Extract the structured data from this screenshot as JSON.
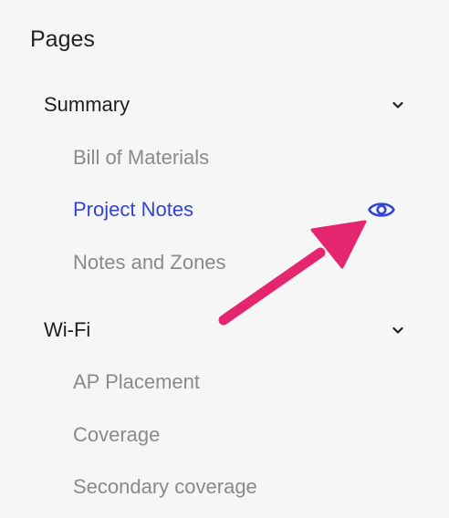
{
  "panel": {
    "title": "Pages"
  },
  "sections": [
    {
      "label": "Summary",
      "items": [
        {
          "label": "Bill of Materials",
          "active": false
        },
        {
          "label": "Project Notes",
          "active": true
        },
        {
          "label": "Notes and Zones",
          "active": false
        }
      ]
    },
    {
      "label": "Wi-Fi",
      "items": [
        {
          "label": "AP Placement",
          "active": false
        },
        {
          "label": "Coverage",
          "active": false
        },
        {
          "label": "Secondary coverage",
          "active": false
        }
      ]
    }
  ],
  "icons": {
    "section_toggle": "chevron-down-icon",
    "active_item_action": "eye-icon",
    "annotation": "arrow-annotation"
  },
  "colors": {
    "background": "#f6f6f6",
    "heading": "#222222",
    "section_label": "#1f1f1f",
    "item_default": "#8a8a8a",
    "item_active": "#3344d6",
    "annotation_arrow": "#e5266e"
  }
}
